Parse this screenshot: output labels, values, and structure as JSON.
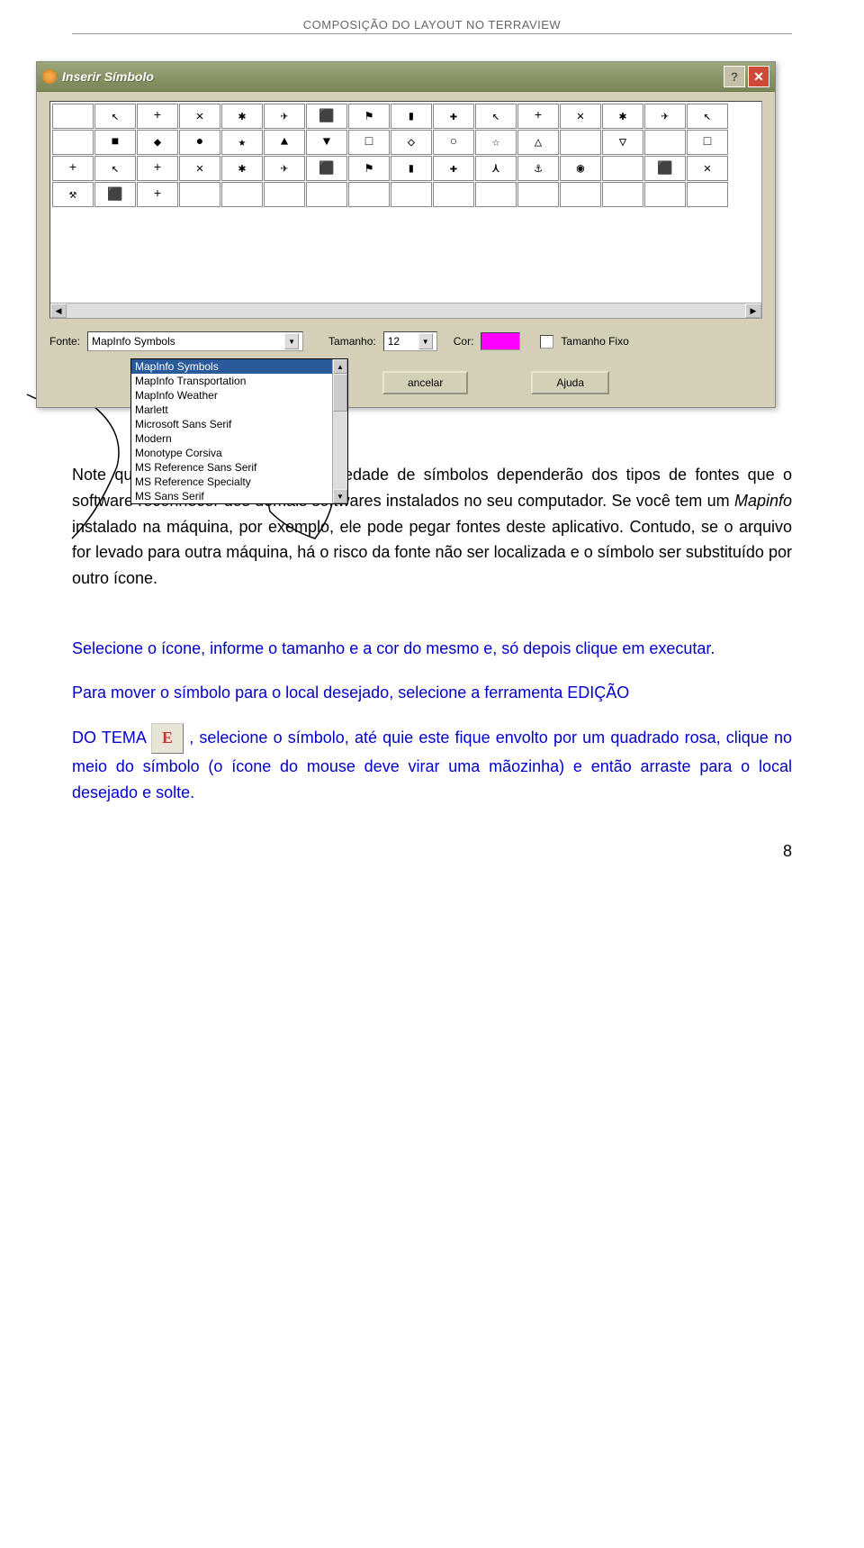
{
  "header": "COMPOSIÇÃO DO LAYOUT NO TERRAVIEW",
  "dialog": {
    "title": "Inserir Símbolo",
    "symbols": [
      "",
      "↖",
      "+",
      "✕",
      "✱",
      "✈",
      "⬛",
      "⚑",
      "▮",
      "✚",
      "↖",
      "+",
      "✕",
      "✱",
      "✈",
      "↖",
      "",
      "■",
      "◆",
      "●",
      "★",
      "▲",
      "▼",
      "□",
      "◇",
      "○",
      "☆",
      "△",
      "",
      "▽",
      "",
      "□",
      "+",
      "↖",
      "+",
      "✕",
      "✱",
      "✈",
      "⬛",
      "⚑",
      "▮",
      "✚",
      "⋏",
      "⚓",
      "◉",
      "",
      "⬛",
      "✕",
      "⚒",
      "⬛",
      "+",
      "",
      "",
      "",
      "",
      "",
      "",
      "",
      "",
      "",
      "",
      "",
      "",
      ""
    ],
    "fonte_label": "Fonte:",
    "fonte_value": "MapInfo Symbols",
    "tamanho_label": "Tamanho:",
    "tamanho_value": "12",
    "cor_label": "Cor:",
    "fixo_label": "Tamanho Fixo",
    "dropdown": [
      "MapInfo Symbols",
      "MapInfo Transportation",
      "MapInfo Weather",
      "Marlett",
      "Microsoft Sans Serif",
      "Modern",
      "Monotype Corsiva",
      "MS Reference Sans Serif",
      "MS Reference Specialty",
      "MS Sans Serif"
    ],
    "btn_cancelar": "ancelar",
    "btn_ajuda": "Ajuda"
  },
  "body": {
    "p1a": "Note que a disponibilidade e a variedade de símbolos dependerão dos tipos de fontes que o software reconhecer dos demais softwares instalados no seu computador. Se você tem um ",
    "p1b": "Mapinfo",
    "p1c": " instalado na máquina, por exemplo, ele pode pegar fontes deste aplicativo. Contudo, se o arquivo for levado para outra máquina, há o risco da fonte não ser localizada e o símbolo ser substituído por outro ícone.",
    "p2": "Selecione o ícone, informe o tamanho e a cor do mesmo e, só depois clique em executar.",
    "p3": "Para mover o símbolo para o local desejado, selecione a ferramenta EDIÇÃO",
    "p4a": "DO TEMA ",
    "p4b": ", selecione o símbolo, até quie este fique envolto por um quadrado rosa, clique no meio do símbolo (o ícone do mouse deve virar uma mãozinha) e então arraste para o local desejado e solte.",
    "edit_icon_letter": "E"
  },
  "page_number": "8"
}
